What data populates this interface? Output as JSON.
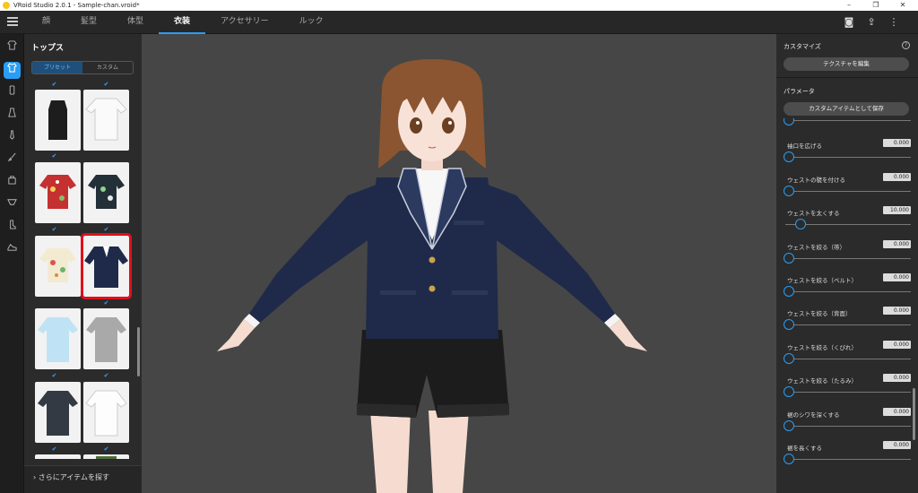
{
  "window": {
    "title": "VRoid Studio 2.0.1 - Sample-chan.vroid*",
    "minimize": "–",
    "restore": "❐",
    "close": "✕"
  },
  "tabs": [
    {
      "label": "顔"
    },
    {
      "label": "髪型"
    },
    {
      "label": "体型"
    },
    {
      "label": "衣装"
    },
    {
      "label": "アクセサリー"
    },
    {
      "label": "ルック"
    }
  ],
  "active_tab": "衣装",
  "top_icons": {
    "camera": "◙",
    "export": "⇪",
    "more": "⋮"
  },
  "rail_icons": [
    "shirt-outline-icon",
    "shirt-icon",
    "dress-icon",
    "skirt-icon",
    "tie-icon",
    "pants-icon",
    "socks-icon",
    "underwear-icon",
    "shoe-icon",
    "accessory-icon"
  ],
  "left_panel": {
    "title": "トップス",
    "segments": [
      "プリセット",
      "カスタム"
    ],
    "checkmark": "✔",
    "more_items": "›  さらにアイテムを探す"
  },
  "right_panel": {
    "customize_title": "カスタマイズ",
    "help": "?",
    "edit_texture": "テクスチャを編集",
    "parameters_title": "パラメータ",
    "save_custom": "カスタムアイテムとして保存",
    "params": [
      {
        "label": "",
        "value": "",
        "level": 0.0
      },
      {
        "label": "袖口を広げる",
        "value": "0.000",
        "level": 0.0
      },
      {
        "label": "ウェストの襞を付ける",
        "value": "0.000",
        "level": 0.0
      },
      {
        "label": "ウェストを太くする",
        "value": "10.000",
        "level": 0.1
      },
      {
        "label": "ウェストを絞る（帯）",
        "value": "0.000",
        "level": 0.0
      },
      {
        "label": "ウェストを絞る（ベルト）",
        "value": "0.000",
        "level": 0.0
      },
      {
        "label": "ウェストを絞る（背面）",
        "value": "0.000",
        "level": 0.0
      },
      {
        "label": "ウェストを絞る（くびれ）",
        "value": "0.000",
        "level": 0.0
      },
      {
        "label": "ウェストを絞る（たるみ）",
        "value": "0.000",
        "level": 0.0
      },
      {
        "label": "裾のシワを深くする",
        "value": "0.000",
        "level": 0.0
      },
      {
        "label": "裾を長くする",
        "value": "0.000",
        "level": 0.0
      }
    ]
  },
  "colors": {
    "accent": "#2a9df4",
    "selection": "#e0101a",
    "blazer": "#1f2a4a",
    "shorts": "#1c1c1c",
    "hair": "#8a5530"
  }
}
